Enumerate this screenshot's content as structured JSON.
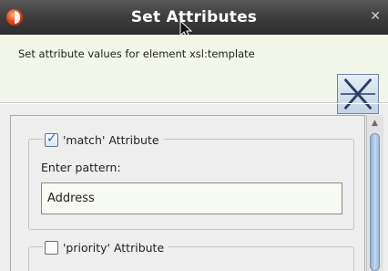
{
  "dialog": {
    "title": "Set Attributes",
    "header_text": "Set attribute values for element xsl:template",
    "app_icon": "app-logo-icon",
    "close_icon": "close-icon",
    "banner_icon": "split-view-icon"
  },
  "attributes": {
    "match": {
      "label": "'match' Attribute",
      "checked": true,
      "field_label": "Enter pattern:",
      "value": "Address"
    },
    "priority": {
      "label": "'priority' Attribute",
      "checked": false
    }
  },
  "scrollbar": {
    "up_icon": "scroll-up-arrow-icon"
  },
  "colors": {
    "titlebar": "#3f3f3f",
    "header_bg": "#f2f7ea",
    "input_bg": "#f7fbf1",
    "check_accent": "#2b69c5"
  }
}
